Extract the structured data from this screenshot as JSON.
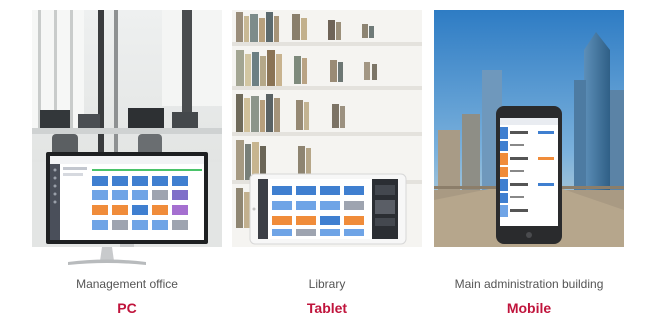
{
  "accent_color": "#c0143c",
  "panels": [
    {
      "scene": "management-office",
      "place": "Management office",
      "device": "PC"
    },
    {
      "scene": "library",
      "place": "Library",
      "device": "Tablet"
    },
    {
      "scene": "city-skyline",
      "place": "Main administration building",
      "device": "Mobile"
    }
  ]
}
